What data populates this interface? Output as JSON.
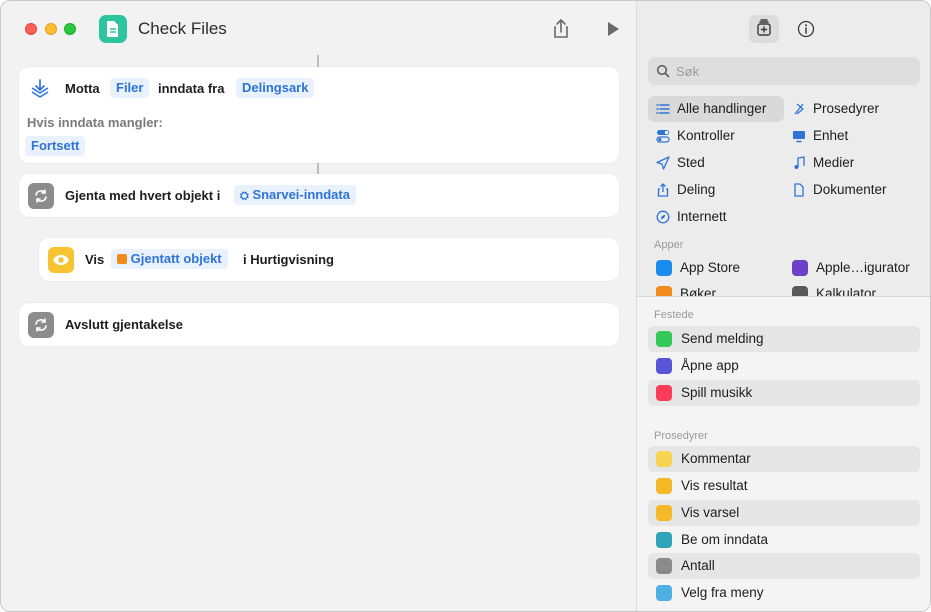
{
  "window": {
    "title": "Check Files"
  },
  "workflow": {
    "receive": {
      "label": "Motta",
      "type_token": "Filer",
      "mid_label": "inndata fra",
      "source_token": "Delingsark",
      "missing_label": "Hvis inndata mangler:",
      "missing_token": "Fortsett"
    },
    "repeat": {
      "label": "Gjenta med hvert objekt i",
      "token": "Snarvei-inndata"
    },
    "show": {
      "label": "Vis",
      "token": "Gjentatt objekt",
      "suffix": "i Hurtigvisning"
    },
    "end_repeat": {
      "label": "Avslutt gjentakelse"
    }
  },
  "library": {
    "search_placeholder": "Søk",
    "categories": [
      {
        "label": "Alle handlinger",
        "icon": "list-icon",
        "selected": true
      },
      {
        "label": "Prosedyrer",
        "icon": "script-icon"
      },
      {
        "label": "Kontroller",
        "icon": "toggle-icon"
      },
      {
        "label": "Enhet",
        "icon": "display-icon"
      },
      {
        "label": "Sted",
        "icon": "location-icon"
      },
      {
        "label": "Medier",
        "icon": "music-note-icon"
      },
      {
        "label": "Deling",
        "icon": "share-icon"
      },
      {
        "label": "Dokumenter",
        "icon": "document-icon"
      },
      {
        "label": "Internett",
        "icon": "compass-icon"
      }
    ],
    "apps_heading": "Apper",
    "apps": [
      {
        "label": "App Store",
        "color": "#1a8cf0"
      },
      {
        "label": "Apple…igurator",
        "color": "#6e3fc8"
      },
      {
        "label": "Bøker",
        "color": "#f28a1c"
      },
      {
        "label": "Kalkulator",
        "color": "#5a5a5a"
      }
    ],
    "pinned_heading": "Festede",
    "pinned": [
      {
        "label": "Send melding",
        "color": "#34c759",
        "icon": "message-icon"
      },
      {
        "label": "Åpne app",
        "color": "#5856d6",
        "icon": "arrow-icon"
      },
      {
        "label": "Spill musikk",
        "color": "#fa3c5a",
        "icon": "music-note-icon"
      }
    ],
    "scripting_heading": "Prosedyrer",
    "scripting": [
      {
        "label": "Kommentar",
        "color": "#f7d354",
        "icon": "lines-icon"
      },
      {
        "label": "Vis resultat",
        "color": "#f5b928",
        "icon": "result-icon"
      },
      {
        "label": "Vis varsel",
        "color": "#f5b928",
        "icon": "alert-icon"
      },
      {
        "label": "Be om inndata",
        "color": "#2fa3b8",
        "icon": "bubble-icon"
      },
      {
        "label": "Antall",
        "color": "#8a8a8a",
        "icon": "sigma-icon"
      },
      {
        "label": "Velg fra meny",
        "color": "#4fb0e6",
        "icon": "menu-icon"
      }
    ]
  }
}
